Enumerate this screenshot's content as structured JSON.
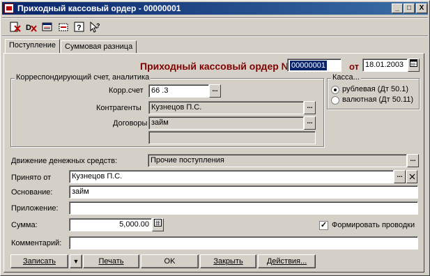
{
  "window": {
    "title": "Приходный кассовый ордер - 00000001",
    "controls": [
      "_",
      "□",
      "X"
    ]
  },
  "toolbar": {
    "icons": [
      "delete-doc-icon",
      "delete-mark-icon",
      "properties-icon",
      "select-icon",
      "help-icon",
      "context-help-icon"
    ]
  },
  "tabs": [
    {
      "label": "Поступление",
      "active": true
    },
    {
      "label": "Суммовая разница",
      "active": false
    }
  ],
  "header": {
    "title": "Приходный кассовый ордер №",
    "number": "00000001",
    "date_label": "от",
    "date": "18.01.2003"
  },
  "analytics": {
    "group_label": "Корреспондирующий счет, аналитика",
    "corr_account_label": "Корр.счет",
    "corr_account": "66 .3",
    "contractors_label": "Контрагенты",
    "contractor": "Кузнецов П.С.",
    "contracts_label": "Договоры",
    "contract": "займ",
    "extra": ""
  },
  "cash": {
    "group_label": "Касса...",
    "options": [
      {
        "label": "рублевая (Дт 50.1)",
        "selected": true
      },
      {
        "label": "валютная (Дт 50.11)",
        "selected": false
      }
    ]
  },
  "form": {
    "cashflow_label": "Движение денежных средств:",
    "cashflow_value": "Прочие поступления",
    "received_from_label": "Принято от",
    "received_from_value": "Кузнецов П.С.",
    "basis_label": "Основание:",
    "basis_value": "займ",
    "attachment_label": "Приложение:",
    "attachment_value": "",
    "amount_label": "Сумма:",
    "amount_value": "5,000.00",
    "postings_label": "Формировать проводки",
    "postings_checked": true,
    "comment_label": "Комментарий:",
    "comment_value": ""
  },
  "buttons": {
    "save": "Записать",
    "save_menu": "▼",
    "print": "Печать",
    "ok": "OK",
    "close": "Закрыть",
    "actions": "Действия..."
  },
  "colors": {
    "titlebar_start": "#0a246a",
    "titlebar_end": "#3a6ea5",
    "accent": "#800000",
    "selection": "#0a246a"
  }
}
